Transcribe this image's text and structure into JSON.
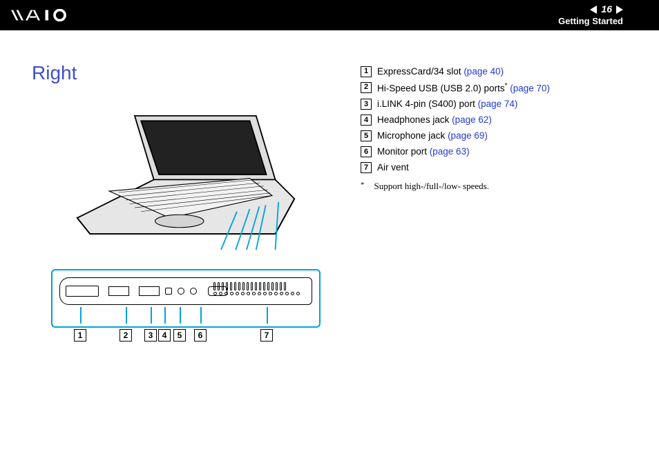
{
  "header": {
    "page_num": "16",
    "section": "Getting Started"
  },
  "title": "Right",
  "legend": [
    {
      "num": "1",
      "text": "ExpressCard/34 slot ",
      "link": "(page 40)",
      "sup": ""
    },
    {
      "num": "2",
      "text": "Hi-Speed USB (USB 2.0) ports",
      "link": "(page 70)",
      "sup": "*"
    },
    {
      "num": "3",
      "text": "i.LINK 4-pin (S400) port ",
      "link": "(page 74)",
      "sup": ""
    },
    {
      "num": "4",
      "text": "Headphones jack ",
      "link": "(page 62)",
      "sup": ""
    },
    {
      "num": "5",
      "text": "Microphone jack ",
      "link": "(page 69)",
      "sup": ""
    },
    {
      "num": "6",
      "text": "Monitor port ",
      "link": "(page 63)",
      "sup": ""
    },
    {
      "num": "7",
      "text": "Air vent",
      "link": "",
      "sup": ""
    }
  ],
  "footnote": {
    "mark": "*",
    "text": "Support high-/full-/low- speeds."
  },
  "callout_numbers": [
    "1",
    "2",
    "3",
    "4",
    "5",
    "6",
    "7"
  ]
}
